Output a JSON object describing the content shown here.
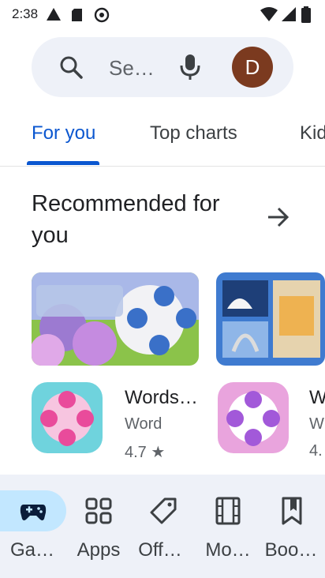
{
  "status_bar": {
    "time": "2:38"
  },
  "search": {
    "placeholder": "Se…",
    "avatar_letter": "D",
    "avatar_color": "#7b3a1f"
  },
  "tabs": [
    {
      "label": "For you",
      "active": true
    },
    {
      "label": "Top charts",
      "active": false
    },
    {
      "label": "Kid",
      "active": false
    }
  ],
  "section": {
    "title": "Recommended for you"
  },
  "apps": [
    {
      "name": "Words…",
      "category": "Word",
      "rating": "4.7 ★"
    },
    {
      "name": "W",
      "category": "W",
      "rating": "4."
    }
  ],
  "bottom_nav": [
    {
      "label": "Ga…",
      "icon": "gamepad-icon",
      "active": true
    },
    {
      "label": "Apps",
      "icon": "apps-grid-icon",
      "active": false
    },
    {
      "label": "Off…",
      "icon": "tag-icon",
      "active": false
    },
    {
      "label": "Mo…",
      "icon": "film-icon",
      "active": false
    },
    {
      "label": "Boo…",
      "icon": "bookmark-icon",
      "active": false
    }
  ],
  "colors": {
    "accent": "#0b57d0",
    "nav_background": "#eef1f8",
    "active_pill": "#c2e7ff"
  }
}
